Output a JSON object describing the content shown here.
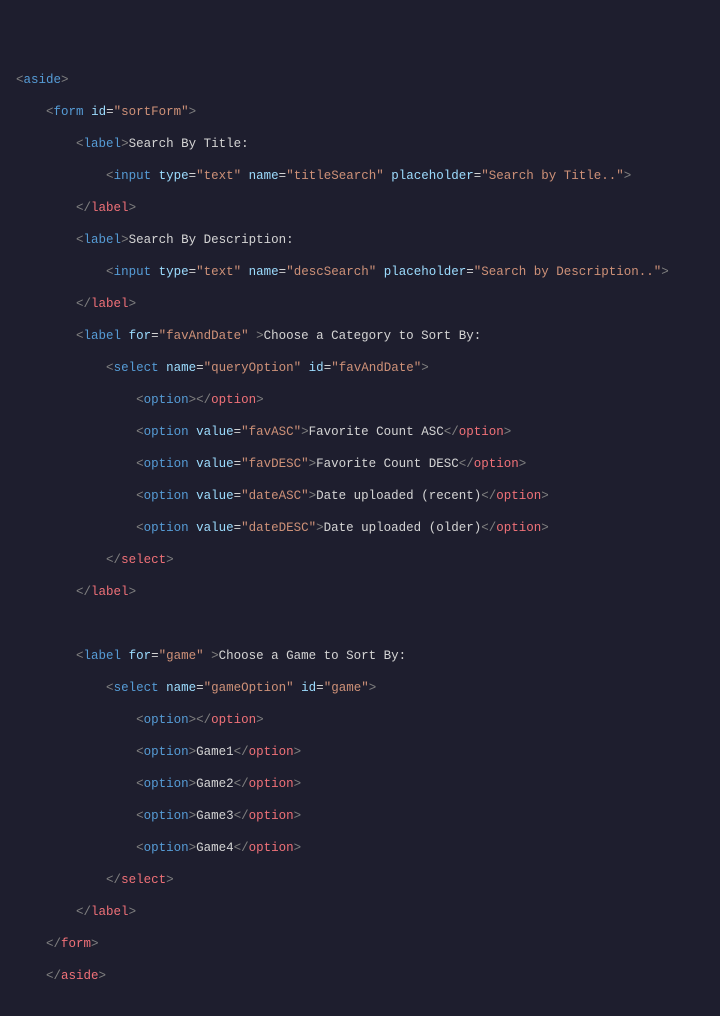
{
  "indent": "    ",
  "tokens": {
    "lt": "<",
    "gt": ">",
    "lts": "</",
    "eq": "="
  },
  "tags": {
    "aside": "aside",
    "form": "form",
    "label": "label",
    "input": "input",
    "select": "select",
    "option": "option"
  },
  "attrs": {
    "id": "id",
    "type": "type",
    "name": "name",
    "placeholder": "placeholder",
    "for": "for",
    "value": "value"
  },
  "vals": {
    "sortForm": "\"sortForm\"",
    "text": "\"text\"",
    "titleSearch": "\"titleSearch\"",
    "titlePH": "\"Search by Title..\"",
    "descSearch": "\"descSearch\"",
    "descPH": "\"Search by Description..\"",
    "favAndDate": "\"favAndDate\"",
    "queryOption": "\"queryOption\"",
    "favASC": "\"favASC\"",
    "favDESC": "\"favDESC\"",
    "dateASC": "\"dateASC\"",
    "dateDESC": "\"dateDESC\"",
    "game": "\"game\"",
    "gameOption": "\"gameOption\""
  },
  "text": {
    "searchByTitle": "Search By Title:",
    "searchByDesc": "Search By Description:",
    "chooseCategory": "Choose a Category to Sort By:",
    "favCountASC": "Favorite Count ASC",
    "favCountDESC": "Favorite Count DESC",
    "dateRecent": "Date uploaded (recent)",
    "dateOlder": "Date uploaded (older)",
    "chooseGame": "Choose a Game to Sort By:",
    "game1": "Game1",
    "game2": "Game2",
    "game3": "Game3",
    "game4": "Game4",
    "space": " "
  }
}
